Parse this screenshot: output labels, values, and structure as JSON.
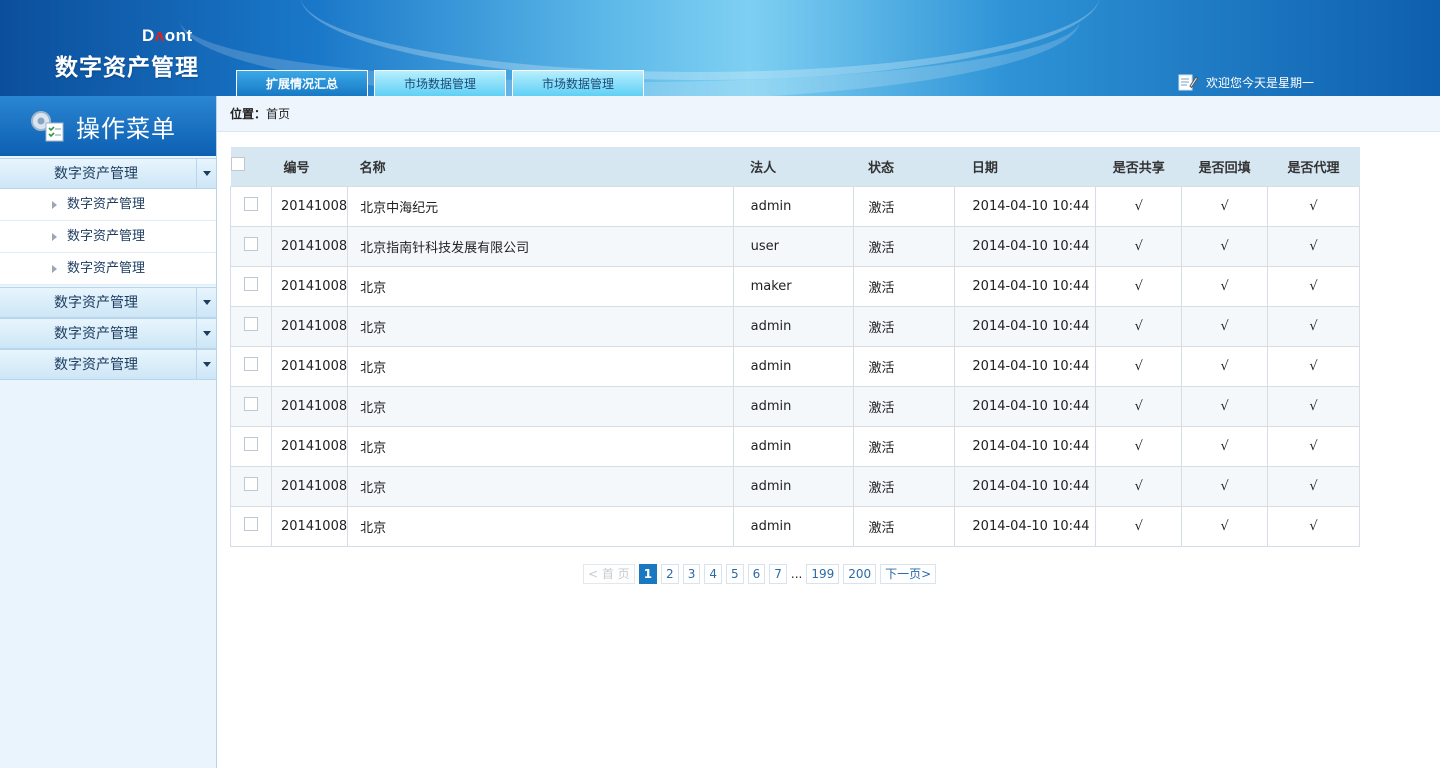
{
  "header": {
    "brand_small_prefix": "D",
    "brand_small_accent": "ʌ",
    "brand_small_suffix": "ont",
    "app_title": "数字资产管理",
    "tabs": [
      {
        "label": "扩展情况汇总",
        "active": true
      },
      {
        "label": "市场数据管理",
        "active": false
      },
      {
        "label": "市场数据管理",
        "active": false
      }
    ],
    "welcome": "欢迎您今天是星期一"
  },
  "sidebar": {
    "title": "操作菜单",
    "groups": [
      {
        "label": "数字资产管理",
        "expanded": true,
        "items": [
          "数字资产管理",
          "数字资产管理",
          "数字资产管理"
        ]
      },
      {
        "label": "数字资产管理",
        "expanded": false
      },
      {
        "label": "数字资产管理",
        "expanded": false
      },
      {
        "label": "数字资产管理",
        "expanded": false
      }
    ]
  },
  "breadcrumb": {
    "label": "位置：",
    "current": "首页"
  },
  "table": {
    "columns": [
      "编号",
      "名称",
      "法人",
      "状态",
      "日期",
      "是否共享",
      "是否回填",
      "是否代理"
    ],
    "rows": [
      {
        "no": "20141008",
        "name": "北京中海纪元",
        "legal": "admin",
        "status": "激活",
        "date": "2014-04-10  10:44",
        "share": "√",
        "backfill": "√",
        "proxy": "√"
      },
      {
        "no": "20141008",
        "name": "北京指南针科技发展有限公司",
        "legal": "user",
        "status": "激活",
        "date": "2014-04-10  10:44",
        "share": "√",
        "backfill": "√",
        "proxy": "√"
      },
      {
        "no": "20141008",
        "name": "北京",
        "legal": "maker",
        "status": "激活",
        "date": "2014-04-10  10:44",
        "share": "√",
        "backfill": "√",
        "proxy": "√"
      },
      {
        "no": "20141008",
        "name": "北京",
        "legal": "admin",
        "status": "激活",
        "date": "2014-04-10  10:44",
        "share": "√",
        "backfill": "√",
        "proxy": "√"
      },
      {
        "no": "20141008",
        "name": "北京",
        "legal": "admin",
        "status": "激活",
        "date": "2014-04-10  10:44",
        "share": "√",
        "backfill": "√",
        "proxy": "√"
      },
      {
        "no": "20141008",
        "name": "北京",
        "legal": "admin",
        "status": "激活",
        "date": "2014-04-10  10:44",
        "share": "√",
        "backfill": "√",
        "proxy": "√"
      },
      {
        "no": "20141008",
        "name": "北京",
        "legal": "admin",
        "status": "激活",
        "date": "2014-04-10  10:44",
        "share": "√",
        "backfill": "√",
        "proxy": "√"
      },
      {
        "no": "20141008",
        "name": "北京",
        "legal": "admin",
        "status": "激活",
        "date": "2014-04-10  10:44",
        "share": "√",
        "backfill": "√",
        "proxy": "√"
      },
      {
        "no": "20141008",
        "name": "北京",
        "legal": "admin",
        "status": "激活",
        "date": "2014-04-10  10:44",
        "share": "√",
        "backfill": "√",
        "proxy": "√"
      }
    ]
  },
  "pager": {
    "first": "< 首 页",
    "pages": [
      "1",
      "2",
      "3",
      "4",
      "5",
      "6",
      "7"
    ],
    "current": "1",
    "ellipsis": "...",
    "tail_pages": [
      "199",
      "200"
    ],
    "next": "下一页>"
  },
  "colors": {
    "accent": "#1978c0",
    "header_dark": "#0b4f9c",
    "link": "#2b6aa6"
  },
  "icons": {
    "welcome": "note-pencil-icon",
    "menu": "gear-checklist-icon"
  }
}
